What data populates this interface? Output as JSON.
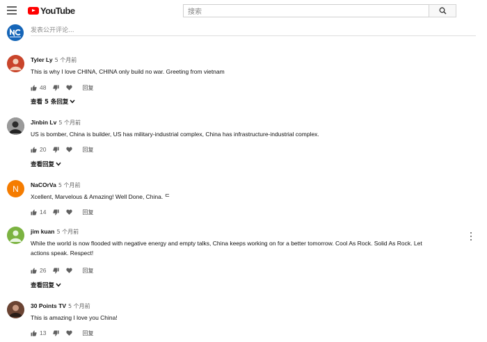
{
  "header": {
    "logo_text": "YouTube",
    "search_placeholder": "搜索"
  },
  "add_comment": {
    "placeholder": "发表公开评论..."
  },
  "comments": [
    {
      "author": "Tyler Ly",
      "time": "5 个月前",
      "text": "This is why I love CHINA, CHINA only build no war. Greeting from vietnam",
      "likes": "48",
      "reply_label": "回复",
      "replies_label": "查看 5 条回复",
      "avatar_color": "#c9452b"
    },
    {
      "author": "Jinbin Lv",
      "time": "5 个月前",
      "text": "US is bomber, China is builder, US has military-industrial complex, China has infrastructure-industrial complex.",
      "likes": "20",
      "reply_label": "回复",
      "replies_label": "查看回复",
      "avatar_color": "#3a3a3a"
    },
    {
      "author": "NaCOrVa",
      "time": "5 个月前",
      "text": "Xcellent, Marvelous & Amazing! Well Done, China. ᄃ",
      "likes": "14",
      "reply_label": "回复",
      "avatar_letter": "N",
      "avatar_color": "#f57c00"
    },
    {
      "author": "jim kuan",
      "time": "5 个月前",
      "text": "While the world is now flooded with negative energy and empty talks, China keeps working on for a better tomorrow.  Cool As Rock.  Solid As Rock.  Let actions speak.  Respect!",
      "likes": "26",
      "reply_label": "回复",
      "replies_label": "查看回复",
      "avatar_color": "#7cb342"
    },
    {
      "author": "30 Points TV",
      "time": "5 个月前",
      "text": "This is amazing I love you China!",
      "likes": "13",
      "reply_label": "回复",
      "avatar_color": "#5d3a2a"
    }
  ]
}
